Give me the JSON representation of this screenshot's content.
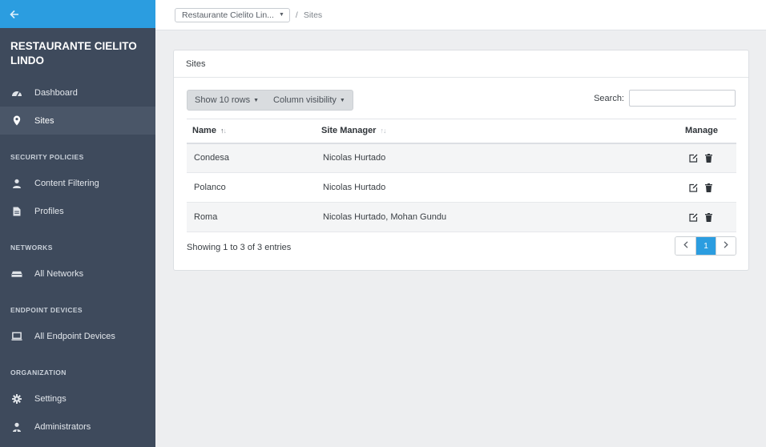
{
  "sidebar": {
    "org_name": "RESTAURANTE CIELITO LINDO",
    "items": [
      {
        "label": "Dashboard"
      },
      {
        "label": "Sites"
      },
      {
        "label": "Content Filtering"
      },
      {
        "label": "Profiles"
      },
      {
        "label": "All Networks"
      },
      {
        "label": "All Endpoint Devices"
      },
      {
        "label": "Settings"
      },
      {
        "label": "Administrators"
      }
    ],
    "sections": [
      "SECURITY POLICIES",
      "NETWORKS",
      "ENDPOINT DEVICES",
      "ORGANIZATION"
    ]
  },
  "breadcrumb": {
    "org_select": "Restaurante Cielito Lin...",
    "separator": "/",
    "current": "Sites"
  },
  "card": {
    "title": "Sites",
    "show_rows_label": "Show 10 rows",
    "column_visibility_label": "Column visibility",
    "search_label": "Search:",
    "search_value": ""
  },
  "table": {
    "columns": [
      "Name",
      "Site Manager",
      "Manage"
    ],
    "rows": [
      {
        "name": "Condesa",
        "manager": "Nicolas Hurtado"
      },
      {
        "name": "Polanco",
        "manager": "Nicolas Hurtado"
      },
      {
        "name": "Roma",
        "manager": "Nicolas Hurtado, Mohan Gundu"
      }
    ]
  },
  "footer": {
    "info": "Showing 1 to 3 of 3 entries",
    "current_page": "1"
  },
  "colors": {
    "accent": "#2b9de0",
    "sidebar_bg": "#3e4a5c"
  }
}
